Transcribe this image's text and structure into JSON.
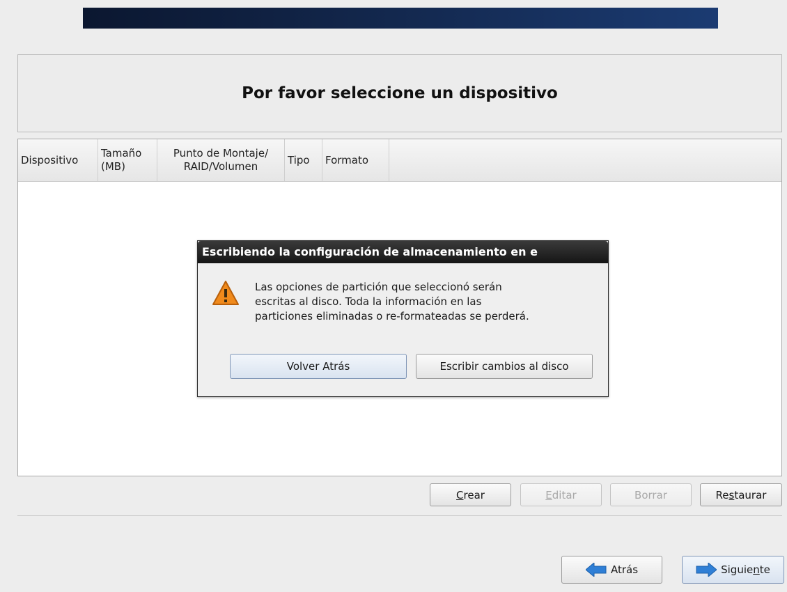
{
  "header": {
    "title": "Por favor seleccione un dispositivo"
  },
  "table": {
    "columns": [
      {
        "line1": "Dispositivo"
      },
      {
        "line1": "Tamaño",
        "line2": "(MB)"
      },
      {
        "line1": "Punto de Montaje/",
        "line2": "RAID/Volumen"
      },
      {
        "line1": "Tipo"
      },
      {
        "line1": "Formato"
      }
    ],
    "rows": []
  },
  "dialog": {
    "title": "Escribiendo la configuración de almacenamiento en e",
    "message": [
      "Las opciones de partición que seleccionó serán",
      "escritas al disco. Toda la información en las",
      "particiones eliminadas o re-formateadas se perderá."
    ],
    "icon": "warning-icon",
    "back_label": "Volver Atrás",
    "write_label": "Escribir cambios al disco"
  },
  "actions": {
    "create": {
      "pre": "",
      "key": "C",
      "post": "rear"
    },
    "edit": {
      "pre": "",
      "key": "E",
      "post": "ditar"
    },
    "delete": {
      "label": "Borrar"
    },
    "reset": {
      "pre": "Re",
      "key": "s",
      "post": "taurar"
    }
  },
  "nav": {
    "back_label": "Atrás",
    "next": {
      "pre": "Siguie",
      "key": "n",
      "post": "te"
    }
  },
  "colors": {
    "banner": "#142a52",
    "arrow": "#2f7fd6",
    "warning": "#f08a1c"
  }
}
